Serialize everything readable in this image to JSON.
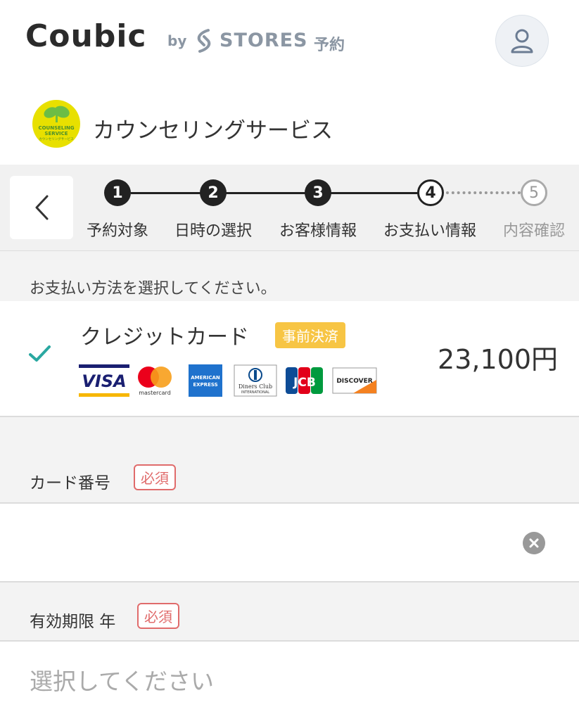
{
  "header": {
    "brand": "Coubic",
    "by": "by",
    "stores": "STORES",
    "stores_suffix": "予約",
    "user_icon": "user-icon"
  },
  "shop": {
    "name": "カウンセリングサービス",
    "logo_text_line1": "COUNSELING",
    "logo_text_line2": "SERVICE",
    "logo_text_line3": "カウンセリングサービス"
  },
  "steps": [
    {
      "number": "1",
      "label": "予約対象",
      "state": "done"
    },
    {
      "number": "2",
      "label": "日時の選択",
      "state": "done"
    },
    {
      "number": "3",
      "label": "お客様情報",
      "state": "done"
    },
    {
      "number": "4",
      "label": "お支払い情報",
      "state": "current"
    },
    {
      "number": "5",
      "label": "内容確認",
      "state": "todo"
    }
  ],
  "payment": {
    "prompt": "お支払い方法を選択してください。",
    "method": "クレジットカード",
    "badge": "事前決済",
    "amount": "23,100円",
    "brands": [
      "VISA",
      "mastercard",
      "AMERICAN EXPRESS",
      "Diners Club INTERNATIONAL",
      "JCB",
      "DISCOVER"
    ]
  },
  "form": {
    "card_number_label": "カード番号",
    "required": "必須",
    "card_number_value": "",
    "expiry_year_label": "有効期限 年",
    "expiry_year_placeholder": "選択してください"
  },
  "colors": {
    "accent_check": "#2aa8a1",
    "badge_yellow": "#f7c544",
    "required_red": "#e06b6b"
  }
}
